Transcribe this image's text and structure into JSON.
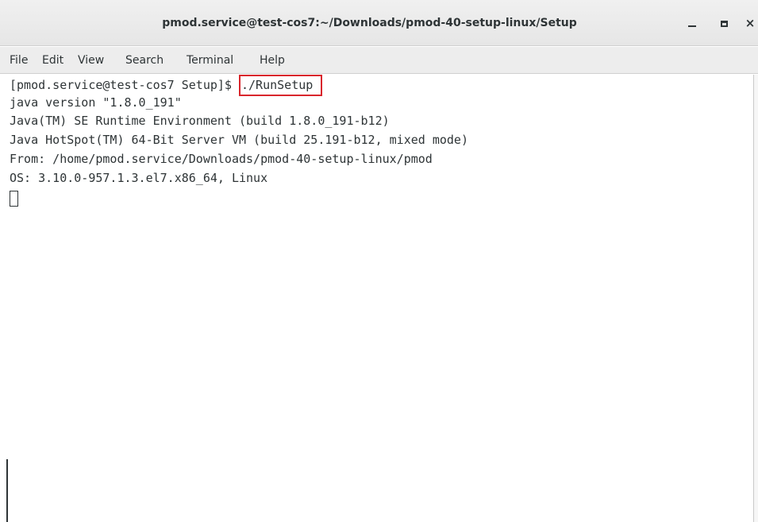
{
  "window": {
    "title": "pmod.service@test-cos7:~/Downloads/pmod-40-setup-linux/Setup",
    "controls": {
      "minimize": "minimize",
      "maximize": "maximize",
      "close": "×"
    }
  },
  "menubar": {
    "items": [
      "File",
      "Edit",
      "View",
      "Search",
      "Terminal",
      "Help"
    ]
  },
  "terminal": {
    "prompt": "[pmod.service@test-cos7 Setup]$ ",
    "command": "./RunSetup",
    "output": [
      "java version \"1.8.0_191\"",
      "Java(TM) SE Runtime Environment (build 1.8.0_191-b12)",
      "Java HotSpot(TM) 64-Bit Server VM (build 25.191-b12, mixed mode)",
      "From: /home/pmod.service/Downloads/pmod-40-setup-linux/pmod",
      "OS: 3.10.0-957.1.3.el7.x86_64, Linux"
    ]
  },
  "colors": {
    "highlight_border": "#d9262c",
    "text": "#2e3436",
    "background": "#ffffff"
  }
}
